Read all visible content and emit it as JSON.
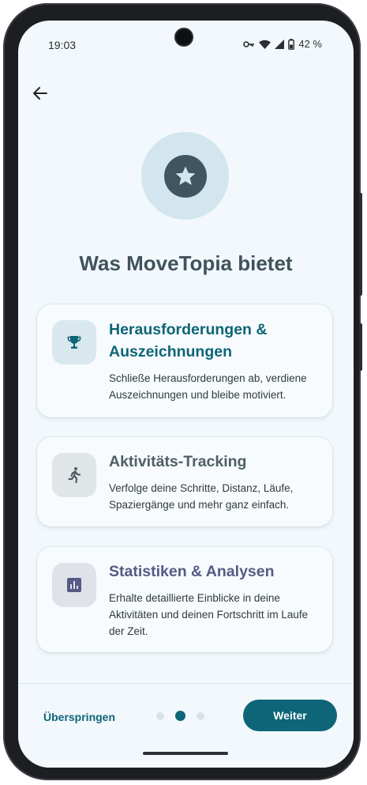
{
  "status_bar": {
    "time": "19:03",
    "battery_percent": "42 %",
    "icons": [
      "vpn-key-icon",
      "wifi-icon",
      "signal-icon",
      "battery-icon"
    ]
  },
  "header": {
    "back_icon": "arrow-left-icon",
    "hero_icon": "star-icon",
    "title": "Was MoveTopia bietet"
  },
  "features": [
    {
      "icon": "trophy-icon",
      "title": "Herausforderungen & Auszeichnungen",
      "description": "Schließe Herausforderungen ab, verdiene Auszeichnungen und bleibe motiviert.",
      "color": "#0d6577"
    },
    {
      "icon": "running-icon",
      "title": "Aktivitäts-Tracking",
      "description": "Verfolge deine Schritte, Distanz, Läufe, Spaziergänge und mehr ganz einfach.",
      "color": "#4f5e66"
    },
    {
      "icon": "bar-chart-icon",
      "title": "Statistiken & Analysen",
      "description": "Erhalte detaillierte Einblicke in deine Aktivitäten und deinen Fortschritt im Laufe der Zeit.",
      "color": "#565b85"
    }
  ],
  "footer": {
    "skip_label": "Überspringen",
    "next_label": "Weiter",
    "page_count": 3,
    "current_page": 2
  },
  "colors": {
    "accent": "#0d6577",
    "background": "#f2f8fb",
    "hero_circle": "#d3e6ef"
  }
}
